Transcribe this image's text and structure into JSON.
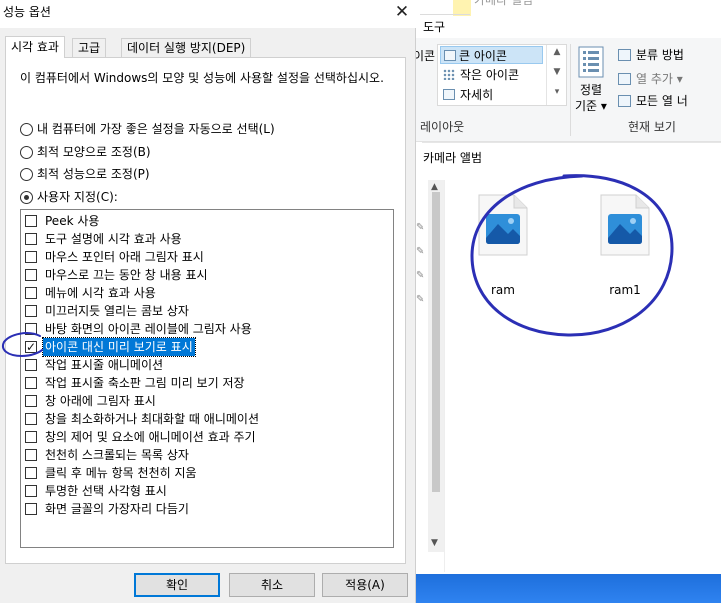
{
  "explorer": {
    "ribbon_tab": "도구",
    "ribbon_tab_ghost": "카메라 앨범",
    "layout": {
      "partial_label": "이콘",
      "items": [
        "큰 아이콘",
        "작은 아이콘",
        "자세히"
      ],
      "selected": "큰 아이콘",
      "group_label": "레이아웃"
    },
    "sort_label_line1": "정렬",
    "sort_label_line2": "기준",
    "current_view": {
      "options": [
        "분류 방법",
        "열 추가",
        "모든 열 너"
      ],
      "group_label": "현재 보기"
    },
    "folder_title": "카메라 앨범",
    "files": [
      {
        "name": "ram"
      },
      {
        "name": "ram1"
      }
    ]
  },
  "dialog": {
    "title": "성능 옵션",
    "close_glyph": "✕",
    "tabs": [
      "시각 효과",
      "고급",
      "데이터 실행 방지(DEP)"
    ],
    "active_tab": "시각 효과",
    "intro": "이 컴퓨터에서 Windows의 모양 및 성능에 사용할 설정을 선택하십시오.",
    "radios": [
      {
        "label": "내 컴퓨터에 가장 좋은 설정을 자동으로 선택(L)",
        "checked": false
      },
      {
        "label": "최적 모양으로 조정(B)",
        "checked": false
      },
      {
        "label": "최적 성능으로 조정(P)",
        "checked": false
      },
      {
        "label": "사용자 지정(C):",
        "checked": true
      }
    ],
    "effects": [
      {
        "label": "Peek 사용",
        "checked": false
      },
      {
        "label": "도구 설명에 시각 효과 사용",
        "checked": false
      },
      {
        "label": "마우스 포인터 아래 그림자 표시",
        "checked": false
      },
      {
        "label": "마우스로 끄는 동안 창 내용 표시",
        "checked": false
      },
      {
        "label": "메뉴에 시각 효과 사용",
        "checked": false
      },
      {
        "label": "미끄러지듯 열리는 콤보 상자",
        "checked": false
      },
      {
        "label": "바탕 화면의 아이콘 레이블에 그림자 사용",
        "checked": false
      },
      {
        "label": "아이콘 대신 미리 보기로 표시",
        "checked": true,
        "selected": true
      },
      {
        "label": "작업 표시줄 애니메이션",
        "checked": false
      },
      {
        "label": "작업 표시줄 축소판 그림 미리 보기 저장",
        "checked": false
      },
      {
        "label": "창 아래에 그림자 표시",
        "checked": false
      },
      {
        "label": "창을 최소화하거나 최대화할 때 애니메이션",
        "checked": false
      },
      {
        "label": "창의 제어 및 요소에 애니메이션 효과 주기",
        "checked": false
      },
      {
        "label": "천천히 스크롤되는 목록 상자",
        "checked": false
      },
      {
        "label": "클릭 후 메뉴 항목 천천히 지움",
        "checked": false
      },
      {
        "label": "투명한 선택 사각형 표시",
        "checked": false
      },
      {
        "label": "화면 글꼴의 가장자리 다듬기",
        "checked": false
      }
    ],
    "buttons": {
      "ok": "확인",
      "cancel": "취소",
      "apply": "적용(A)"
    }
  },
  "colors": {
    "selection": "#0078d7",
    "annotation": "#2b2fb5",
    "taskbar": "#1e6fdc"
  }
}
